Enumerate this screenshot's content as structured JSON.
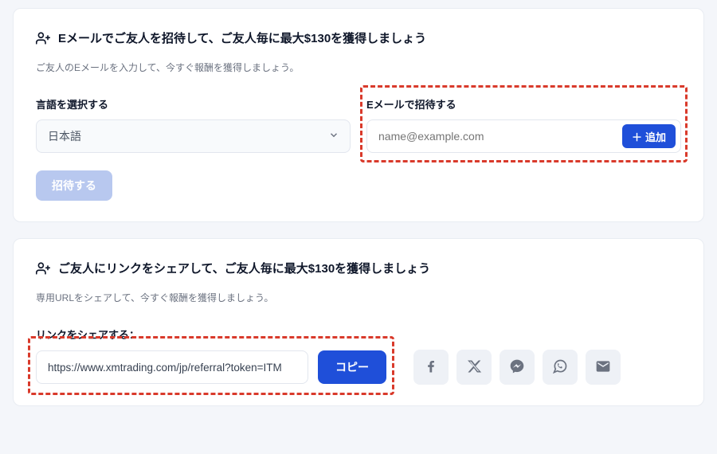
{
  "emailCard": {
    "title": "Eメールでご友人を招待して、ご友人毎に最大$130を獲得しましょう",
    "subtitle": "ご友人のEメールを入力して、今すぐ報酬を獲得しましょう。",
    "languageLabel": "言語を選択する",
    "languageValue": "日本語",
    "emailLabel": "Eメールで招待する",
    "emailPlaceholder": "name@example.com",
    "addBtn": "追加",
    "inviteBtn": "招待する"
  },
  "linkCard": {
    "title": "ご友人にリンクをシェアして、ご友人毎に最大$130を獲得しましょう",
    "subtitle": "専用URLをシェアして、今すぐ報酬を獲得しましょう。",
    "shareLabel": "リンクをシェアする：",
    "shareUrl": "https://www.xmtrading.com/jp/referral?token=ITM",
    "copyBtn": "コピー"
  }
}
